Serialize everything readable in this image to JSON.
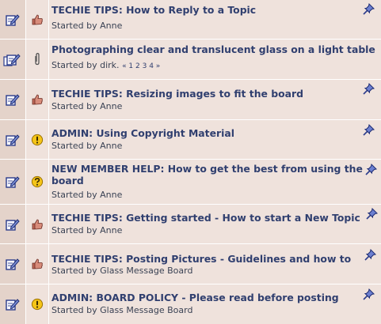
{
  "topics": [
    {
      "title": "TECHIE TIPS: How to Reply to a Topic",
      "starter_prefix": "Started by",
      "starter": "Anne",
      "icon": "thumb-icon",
      "pages": ""
    },
    {
      "title": "Photographing clear and translucent glass on a light table",
      "starter_prefix": "Started by",
      "starter": "dirk.",
      "icon": "paperclip-icon",
      "pages": "« 1 2 3 4 »"
    },
    {
      "title": "TECHIE TIPS: Resizing images to fit the board",
      "starter_prefix": "Started by",
      "starter": "Anne",
      "icon": "thumb-icon",
      "pages": ""
    },
    {
      "title": "ADMIN: Using Copyright Material",
      "starter_prefix": "Started by",
      "starter": "Anne",
      "icon": "exclamation-icon",
      "pages": ""
    },
    {
      "title": "NEW MEMBER HELP: How to get the best from using the board",
      "starter_prefix": "Started by",
      "starter": "Anne",
      "icon": "question-icon",
      "pages": ""
    },
    {
      "title": "TECHIE TIPS: Getting started - How to start a New Topic",
      "starter_prefix": "Started by",
      "starter": "Anne",
      "icon": "thumb-icon",
      "pages": ""
    },
    {
      "title": "TECHIE TIPS: Posting Pictures - Guidelines and how to",
      "starter_prefix": "Started by",
      "starter": "Glass Message Board",
      "icon": "thumb-icon",
      "pages": ""
    },
    {
      "title": "ADMIN: BOARD POLICY - Please read before posting",
      "starter_prefix": "Started by",
      "starter": "Glass Message Board",
      "icon": "exclamation-icon",
      "pages": ""
    }
  ],
  "colors": {
    "status_cell": "#e4d3ca",
    "row_background": "#efe2dc",
    "title_text": "#303f6f",
    "starter_text": "#3a4254"
  }
}
